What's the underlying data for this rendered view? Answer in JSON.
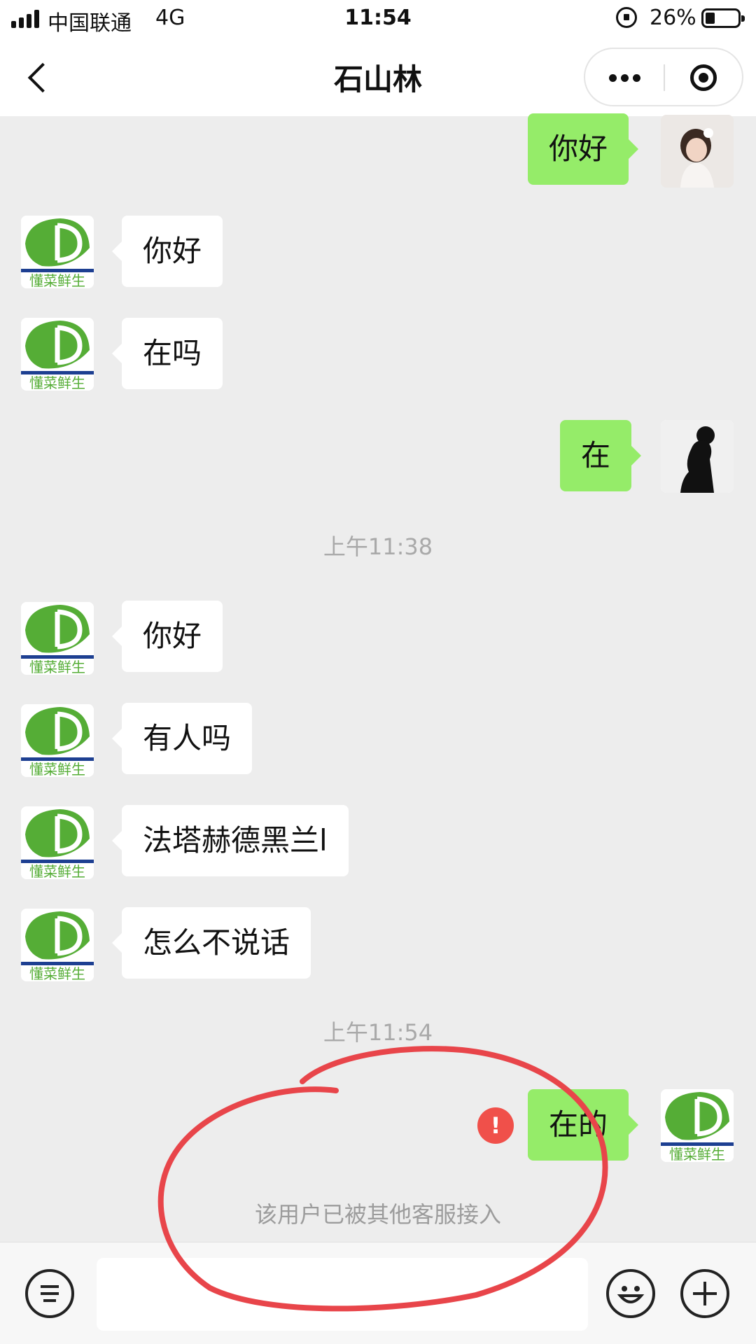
{
  "status_bar": {
    "carrier": "中国联通",
    "network": "4G",
    "time": "11:54",
    "battery_percent": "26%",
    "battery_level": 0.26
  },
  "nav": {
    "title": "石山林"
  },
  "messages": [
    {
      "side": "out",
      "text": "你好",
      "avatar": "girl-photo-avatar"
    },
    {
      "side": "in",
      "text": "你好",
      "avatar": "dong-cai-xian-sheng-logo"
    },
    {
      "side": "in",
      "text": "在吗",
      "avatar": "dong-cai-xian-sheng-logo"
    },
    {
      "side": "out",
      "text": "在",
      "avatar": "silhouette-avatar"
    },
    {
      "timestamp": "上午11:38"
    },
    {
      "side": "in",
      "text": "你好",
      "avatar": "dong-cai-xian-sheng-logo"
    },
    {
      "side": "in",
      "text": "有人吗",
      "avatar": "dong-cai-xian-sheng-logo"
    },
    {
      "side": "in",
      "text": "法塔赫德黑兰l",
      "avatar": "dong-cai-xian-sheng-logo"
    },
    {
      "side": "in",
      "text": "怎么不说话",
      "avatar": "dong-cai-xian-sheng-logo"
    },
    {
      "timestamp": "上午11:54"
    },
    {
      "side": "out",
      "text": "在的",
      "avatar": "dong-cai-xian-sheng-logo",
      "failed": true
    }
  ],
  "timestamps": [
    "上午11:38",
    "上午11:54"
  ],
  "system_notice": "该用户已被其他客服接入",
  "error_mark": "!",
  "logo_text": "懂菜鲜生",
  "colors": {
    "out_bubble": "#95ec69",
    "in_bubble": "#ffffff",
    "chat_bg": "#ededed",
    "error": "#f0504a",
    "annotation_circle": "#e8454a"
  }
}
